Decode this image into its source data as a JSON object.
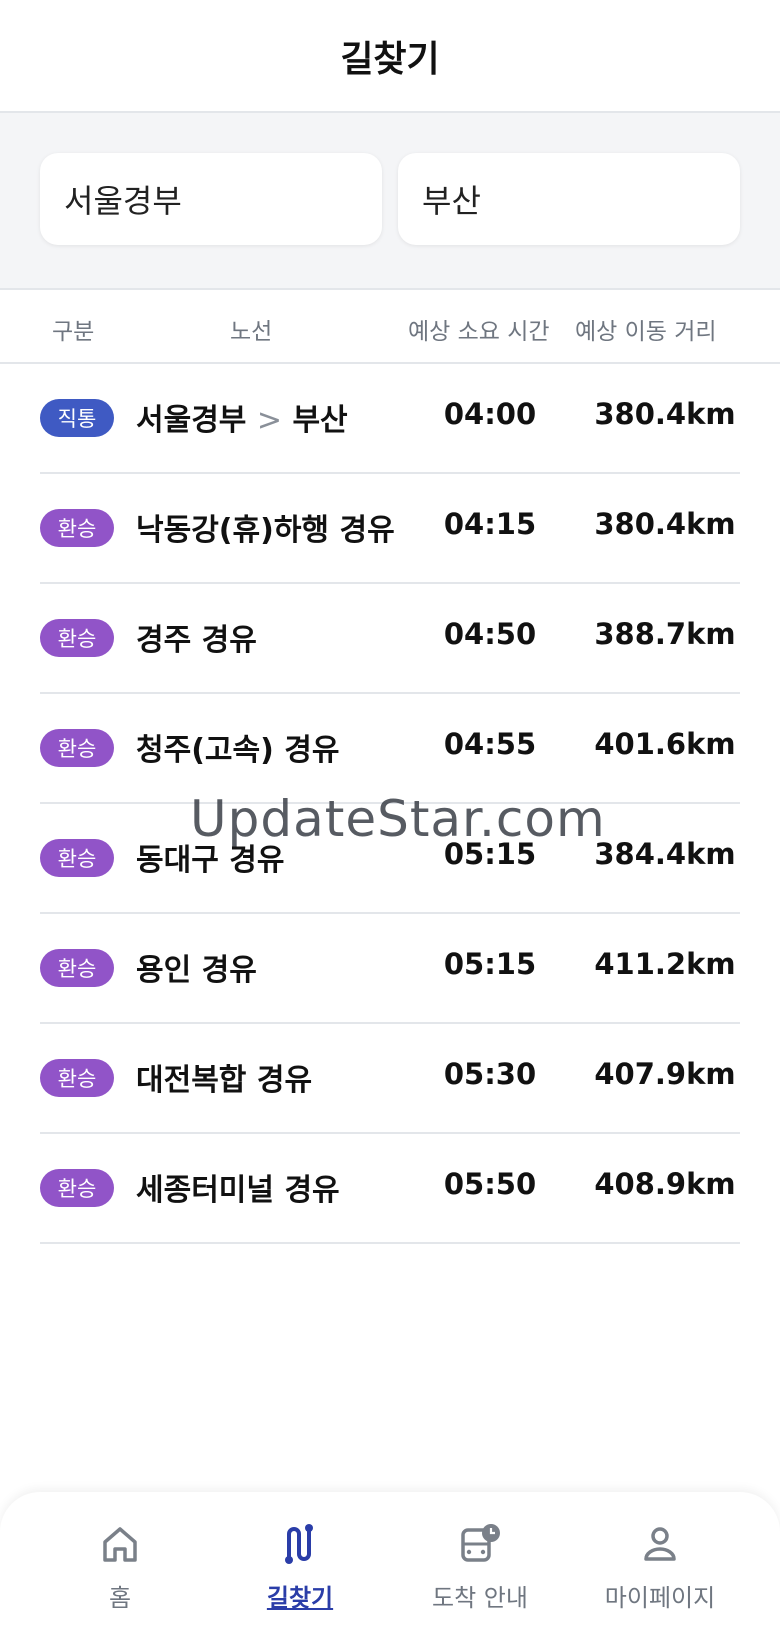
{
  "header": {
    "title": "길찾기"
  },
  "search": {
    "origin": "서울경부",
    "destination": "부산"
  },
  "columns": {
    "type": "구분",
    "route": "노선",
    "time": "예상 소요 시간",
    "distance": "예상 이동 거리"
  },
  "routes": [
    {
      "badge": "직통",
      "badge_kind": "direct",
      "from": "서울경부",
      "separator": ">",
      "to": "부산",
      "time": "04:00",
      "distance": "380.4km"
    },
    {
      "badge": "환승",
      "badge_kind": "transfer",
      "name": "낙동강(휴)하행 경유",
      "time": "04:15",
      "distance": "380.4km"
    },
    {
      "badge": "환승",
      "badge_kind": "transfer",
      "name": "경주 경유",
      "time": "04:50",
      "distance": "388.7km"
    },
    {
      "badge": "환승",
      "badge_kind": "transfer",
      "name": "청주(고속) 경유",
      "time": "04:55",
      "distance": "401.6km"
    },
    {
      "badge": "환승",
      "badge_kind": "transfer",
      "name": "동대구 경유",
      "time": "05:15",
      "distance": "384.4km"
    },
    {
      "badge": "환승",
      "badge_kind": "transfer",
      "name": "용인 경유",
      "time": "05:15",
      "distance": "411.2km"
    },
    {
      "badge": "환승",
      "badge_kind": "transfer",
      "name": "대전복합 경유",
      "time": "05:30",
      "distance": "407.9km"
    },
    {
      "badge": "환승",
      "badge_kind": "transfer",
      "name": "세종터미널 경유",
      "time": "05:50",
      "distance": "408.9km"
    }
  ],
  "watermark": "UpdateStar.com",
  "nav": {
    "home": {
      "label": "홈",
      "icon": "home-icon"
    },
    "route": {
      "label": "길찾기",
      "icon": "route-icon",
      "active": true
    },
    "arrival": {
      "label": "도착 안내",
      "icon": "bus-clock-icon"
    },
    "mypage": {
      "label": "마이페이지",
      "icon": "person-icon"
    }
  },
  "colors": {
    "direct_badge": "#3f5ac3",
    "transfer_badge": "#9154c8",
    "active_nav": "#2a3da8"
  }
}
